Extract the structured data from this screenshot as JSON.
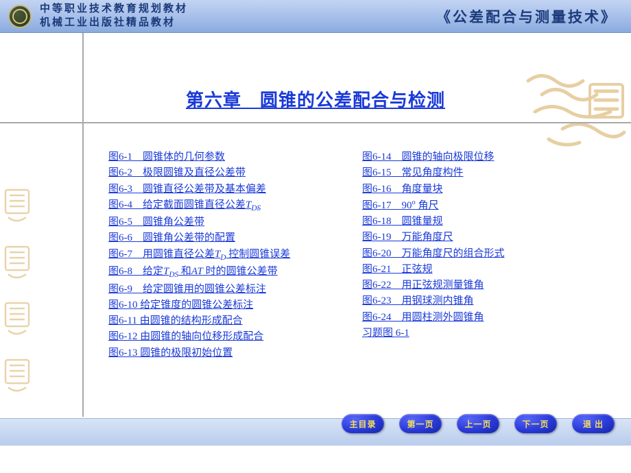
{
  "header": {
    "line1": "中等职业技术教育规划教材",
    "line2": "机械工业出版社精品教材",
    "right": "《公差配合与测量技术》"
  },
  "chapter_title": "第六章　圆锥的公差配合与检测",
  "links_left": [
    {
      "label": "图6-1　圆锥体的几何参数"
    },
    {
      "label": "图6-2　极限圆锥及直径公差带"
    },
    {
      "label": "图6-3　圆锥直径公差带及基本偏差"
    },
    {
      "label_html": "图6-4　给定截面圆锥直径公差<em>T</em><sub>DS</sub>"
    },
    {
      "label": "图6-5　圆锥角公差带"
    },
    {
      "label": "图6-6　圆锥角公差带的配置"
    },
    {
      "label_html": "图6-7　用圆锥直径公差<em>T</em><sub>D</sub> 控制圆锥误差"
    },
    {
      "label_html": "图6-8　给定<em>T</em><sub>DS</sub> 和<em>AT</em> 时的圆锥公差带"
    },
    {
      "label": "图6-9　给定圆锥用的圆锥公差标注"
    },
    {
      "label": "图6-10  给定锥度的圆锥公差标注"
    },
    {
      "label": "图6-11  由圆锥的结构形成配合"
    },
    {
      "label": "图6-12  由圆锥的轴向位移形成配合"
    },
    {
      "label": "图6-13  圆锥的极限初始位置"
    }
  ],
  "links_right": [
    {
      "label": "图6-14　圆锥的轴向极限位移"
    },
    {
      "label": "图6-15　常见角度构件"
    },
    {
      "label": "图6-16　角度量块"
    },
    {
      "label_html": "图6-17　90<sup>o</sup> 角尺"
    },
    {
      "label": "图6-18　圆锥量规"
    },
    {
      "label": "图6-19　万能角度尺"
    },
    {
      "label": "图6-20　万能角度尺的组合形式"
    },
    {
      "label": "图6-21　正弦规"
    },
    {
      "label": "图6-22　用正弦规测量锥角"
    },
    {
      "label": "图6-23　用钢球测内锥角"
    },
    {
      "label": "图6-24　用圆柱测外圆锥角"
    },
    {
      "label": "习题图 6-1"
    }
  ],
  "buttons": {
    "home": "主目录",
    "first": "第一页",
    "prev": "上一页",
    "next": "下一页",
    "exit": "退 出"
  }
}
